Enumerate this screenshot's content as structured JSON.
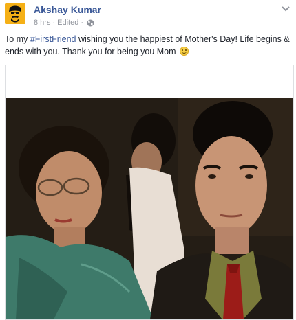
{
  "post": {
    "author": "Akshay Kumar",
    "timestamp": "8 hrs",
    "edited_label": "Edited",
    "separator": "·",
    "privacy_icon": "globe-icon",
    "options_icon": "chevron-down-icon",
    "caption": {
      "prefix": "To my ",
      "hashtag": "#FirstFriend",
      "suffix": " wishing you the happiest of Mother's Day! Life begins & ends with you. Thank you for being you Mom",
      "emoji": "smiley-emoji"
    },
    "photo_icon": "family-photo"
  },
  "colors": {
    "link_blue": "#3b5998",
    "meta_gray": "#90949c",
    "avatar_bg": "#f5b016"
  }
}
